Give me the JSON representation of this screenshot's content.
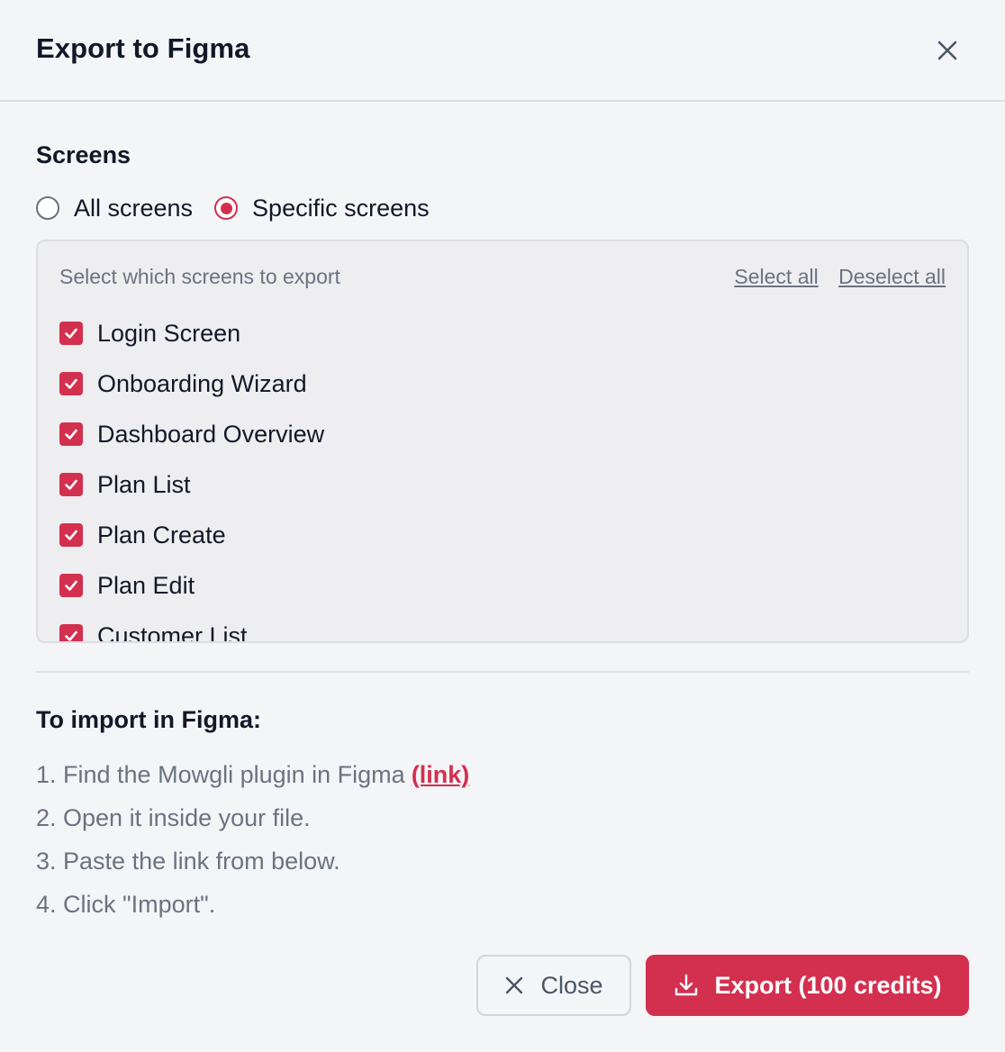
{
  "dialog": {
    "title": "Export to Figma",
    "close_icon": "close-icon"
  },
  "screens": {
    "label": "Screens",
    "options": [
      {
        "label": "All screens",
        "selected": false
      },
      {
        "label": "Specific screens",
        "selected": true
      }
    ],
    "list_header": "Select which screens to export",
    "select_all": "Select all",
    "deselect_all": "Deselect all",
    "items": [
      {
        "label": "Login Screen",
        "checked": true
      },
      {
        "label": "Onboarding Wizard",
        "checked": true
      },
      {
        "label": "Dashboard Overview",
        "checked": true
      },
      {
        "label": "Plan List",
        "checked": true
      },
      {
        "label": "Plan Create",
        "checked": true
      },
      {
        "label": "Plan Edit",
        "checked": true
      },
      {
        "label": "Customer List",
        "checked": true
      }
    ]
  },
  "import": {
    "title": "To import in Figma:",
    "steps": [
      {
        "text": "1. Find the Mowgli plugin in Figma",
        "link": "(link)"
      },
      {
        "text": "2. Open it inside your file."
      },
      {
        "text": "3. Paste the link from below."
      },
      {
        "text": "4. Click \"Import\"."
      }
    ]
  },
  "buttons": {
    "close_label": "Close",
    "export_label": "Export (100 credits)"
  },
  "colors": {
    "accent": "#d3304f",
    "background": "#f4f5f7",
    "muted_text": "#6b7280"
  }
}
